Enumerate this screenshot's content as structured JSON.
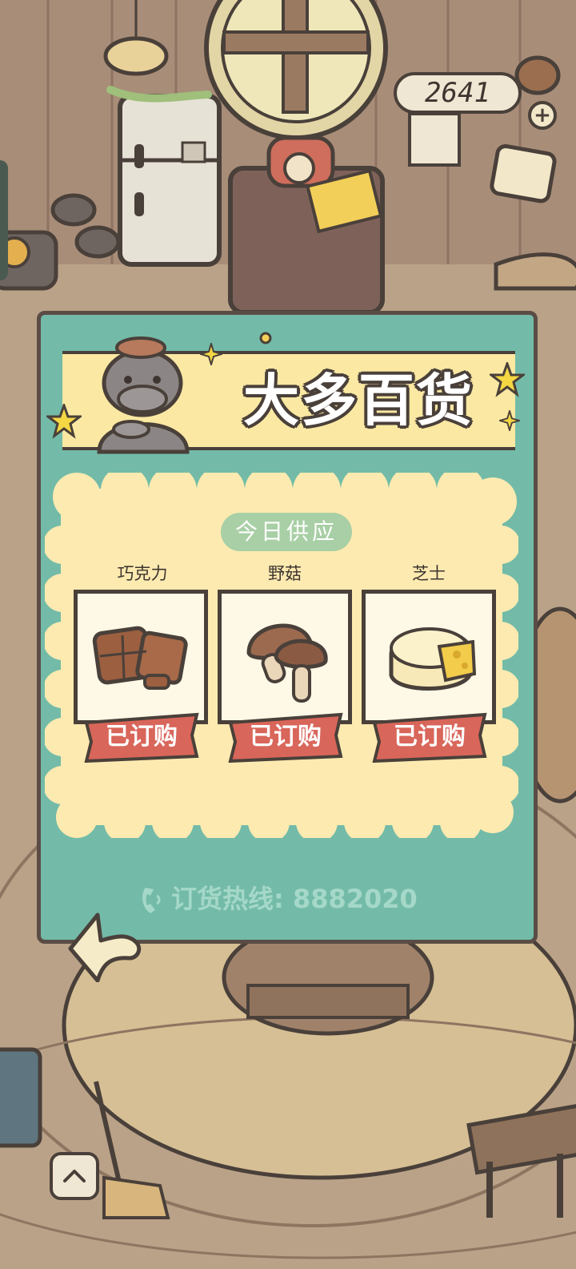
{
  "hud": {
    "coins": "2641",
    "add_symbol": "+"
  },
  "shop": {
    "title": "大多百货",
    "subtitle": "今日供应",
    "items": [
      {
        "name": "巧克力",
        "status": "已订购",
        "icon": "chocolate-icon"
      },
      {
        "name": "野菇",
        "status": "已订购",
        "icon": "mushroom-icon"
      },
      {
        "name": "芝士",
        "status": "已订购",
        "icon": "cheese-icon"
      }
    ],
    "hotline": "订货热线: 8882020"
  },
  "icons": {
    "back": "back-arrow-icon",
    "home": "chevron-up-icon",
    "phone": "phone-icon"
  },
  "colors": {
    "panel": "#73bba8",
    "banner": "#fbe8a2",
    "inner": "#fdeab0",
    "ribbon": "#d9665a",
    "outline": "#4a403a"
  }
}
